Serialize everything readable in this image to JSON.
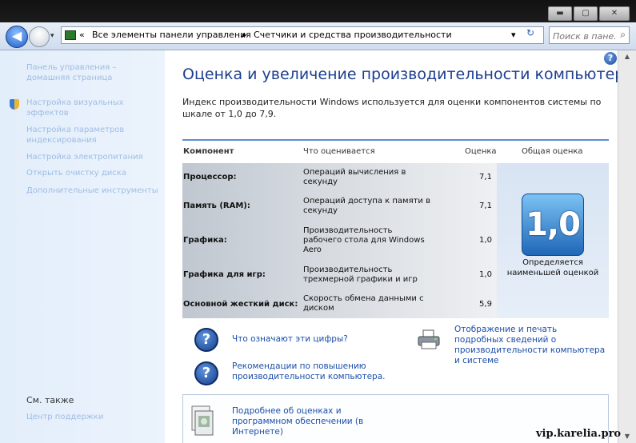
{
  "window": {
    "min_label": "▬",
    "max_label": "▢",
    "close_label": "✕"
  },
  "nav": {
    "back_glyph": "◀",
    "breadcrumb_chevron": "«",
    "breadcrumb": [
      "Все элементы панели управления",
      "Счетчики и средства производительности"
    ],
    "separator": "▸",
    "dropdown": "▾",
    "refresh": "↻",
    "search_placeholder": "Поиск в пане...",
    "search_glyph": "⌕"
  },
  "sidebar": {
    "links": [
      "Панель управления –",
      "домашняя страница",
      "Настройка визуальных",
      "эффектов",
      "Настройка параметров",
      "индексирования",
      "Настройка электропитания",
      "Открыть очистку диска",
      "Дополнительные инструменты"
    ],
    "see_also": "См. также",
    "see_also_link": "Центр поддержки"
  },
  "help_glyph": "?",
  "main": {
    "title": "Оценка и увеличение производительности компьютера",
    "intro": "Индекс производительности Windows используется для оценки компонентов системы по шкале от 1,0 до 7,9.",
    "headers": {
      "component": "Компонент",
      "rated": "Что оценивается",
      "score": "Оценка",
      "overall": "Общая оценка"
    },
    "rows": [
      {
        "name": "Процессор:",
        "desc": "Операций вычисления в секунду",
        "score": "7,1"
      },
      {
        "name": "Память (RAM):",
        "desc": "Операций доступа к памяти в секунду",
        "score": "7,1"
      },
      {
        "name": "Графика:",
        "desc": "Производительность рабочего стола для Windows Aero",
        "score": "1,0"
      },
      {
        "name": "Графика для игр:",
        "desc": "Производительность трехмерной графики и игр",
        "score": "1,0"
      },
      {
        "name": "Основной жесткий диск:",
        "desc": "Скорость обмена данными с диском",
        "score": "5,9"
      }
    ],
    "overall_score": "1,0",
    "overall_note": "Определяется наименьшей оценкой",
    "q_glyph": "?",
    "link_numbers": "Что означают эти цифры?",
    "link_tips": "Рекомендации по повышению производительности компьютера.",
    "link_print": "Отображение и печать подробных сведений о производительности компьютера и системе",
    "link_online": "Подробнее об оценках и программном обеспечении (в Интернете)"
  },
  "scroll": {
    "up": "▲",
    "down": "▼"
  },
  "watermark": "vip.karelia.pro",
  "colors": {
    "accent": "#1e3f8e",
    "link": "#1a4ea8",
    "badge": "#1f67b8",
    "table_border": "#5a8fd1"
  }
}
